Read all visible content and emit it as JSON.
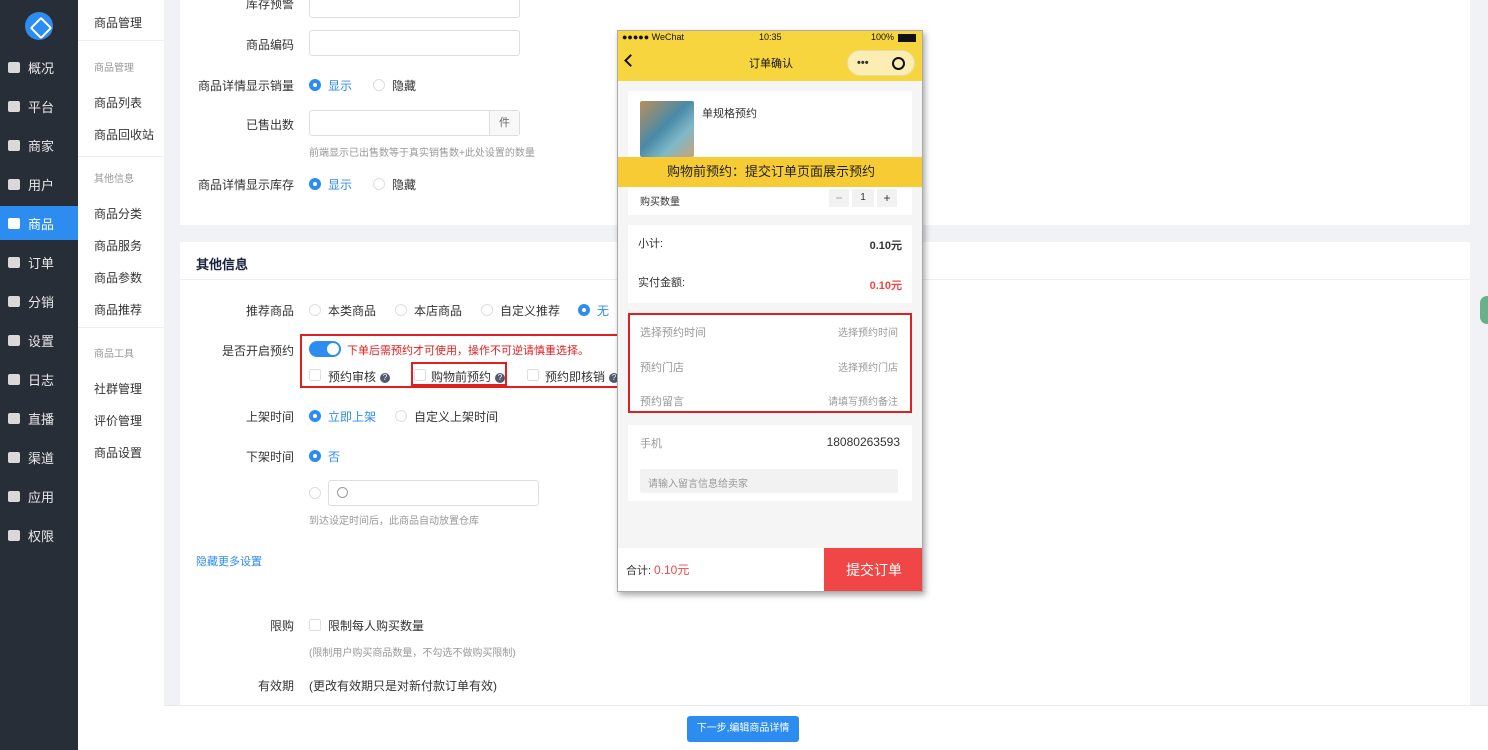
{
  "nav": {
    "items": [
      "概况",
      "平台",
      "商家",
      "用户",
      "商品",
      "订单",
      "分销",
      "设置",
      "日志",
      "直播",
      "渠道",
      "应用",
      "权限"
    ],
    "active": "商品"
  },
  "submenu": {
    "top": "商品管理",
    "groups": [
      {
        "title": "商品管理",
        "items": [
          "商品列表",
          "商品回收站"
        ]
      },
      {
        "title": "其他信息",
        "items": [
          "商品分类",
          "商品服务",
          "商品参数",
          "商品推荐"
        ]
      },
      {
        "title": "商品工具",
        "items": [
          "社群管理",
          "评价管理",
          "商品设置"
        ]
      }
    ]
  },
  "form_top": {
    "stock_warn_label": "库存预警",
    "code_label": "商品编码",
    "show_sales_label": "商品详情显示销量",
    "show": "显示",
    "hide": "隐藏",
    "sold_label": "已售出数",
    "sold_unit": "件",
    "sold_hint": "前端显示已出售数等于真实销售数+此处设置的数量",
    "show_stock_label": "商品详情显示库存"
  },
  "other": {
    "section_title": "其他信息",
    "recommend_label": "推荐商品",
    "recommend_options": [
      "本类商品",
      "本店商品",
      "自定义推荐",
      "无"
    ],
    "reserve_label": "是否开启预约",
    "reserve_warning": "下单后需预约才可使用，操作不可逆请慎重选择。",
    "reserve_checks": [
      "预约审核",
      "购物前预约",
      "预约即核销"
    ],
    "shelf_on_label": "上架时间",
    "shelf_on_options": [
      "立即上架",
      "自定义上架时间"
    ],
    "shelf_off_label": "下架时间",
    "shelf_off_no": "否",
    "shelf_off_hint": "到达设定时间后，此商品自动放置仓库",
    "more_link": "隐藏更多设置",
    "limit_label": "限购",
    "limit_check": "限制每人购买数量",
    "limit_hint": "(限制用户购买商品数量，不勾选不做购买限制)",
    "valid_label": "有效期",
    "valid_text": "(更改有效期只是对新付款订单有效)"
  },
  "next_button": "下一步,编辑商品详情",
  "phone": {
    "carrier": "●●●●● WeChat",
    "time": "10:35",
    "battery": "100%",
    "title": "订单确认",
    "product_name": "单规格预约",
    "banner": "购物前预约：提交订单页面展示预约",
    "qty_label": "购买数量",
    "qty": "1",
    "qty_minus": "−",
    "qty_plus": "+",
    "subtotal_label": "小计:",
    "subtotal": "0.10元",
    "pay_label": "实付金额:",
    "pay": "0.10元",
    "time_label": "选择预约时间",
    "time_ph": "选择预约时间",
    "store_label": "预约门店",
    "store_ph": "选择预约门店",
    "note_label": "预约留言",
    "note_ph": "请填写预约备注",
    "phone_label": "手机",
    "phone_value": "18080263593",
    "msg_ph": "请输入留言信息给卖家",
    "total_label": "合计:",
    "total": "0.10元",
    "submit": "提交订单"
  },
  "colors": {
    "accent": "#2d8cf0",
    "nav_bg": "#282e38",
    "alert": "#e02020",
    "wechat_yellow": "#f7d53f",
    "submit_red": "#f04646"
  }
}
